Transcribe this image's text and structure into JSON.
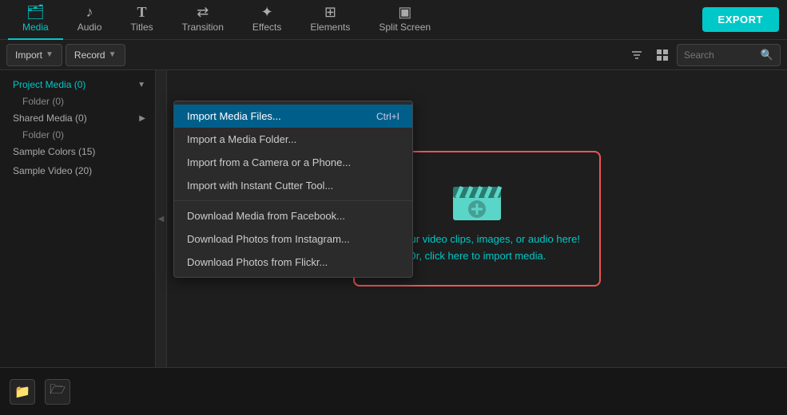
{
  "topNav": {
    "items": [
      {
        "id": "media",
        "label": "Media",
        "icon": "🗂",
        "active": true
      },
      {
        "id": "audio",
        "label": "Audio",
        "icon": "♪"
      },
      {
        "id": "titles",
        "label": "Titles",
        "icon": "T"
      },
      {
        "id": "transition",
        "label": "Transition",
        "icon": "⇄"
      },
      {
        "id": "effects",
        "label": "Effects",
        "icon": "✦"
      },
      {
        "id": "elements",
        "label": "Elements",
        "icon": "⊞"
      },
      {
        "id": "splitscreen",
        "label": "Split Screen",
        "icon": "▣"
      }
    ],
    "export_label": "EXPORT"
  },
  "toolbar": {
    "import_label": "Import",
    "record_label": "Record",
    "search_placeholder": "Search"
  },
  "sidebar": {
    "items": [
      {
        "id": "project-media",
        "label": "Project Media (0)",
        "has_chevron": true,
        "active": true
      },
      {
        "id": "folder",
        "label": "Folder (0)",
        "indent": true
      },
      {
        "id": "shared-media",
        "label": "Shared Media (0)",
        "has_chevron": true
      },
      {
        "id": "shared-folder",
        "label": "Folder (0)",
        "indent": true
      },
      {
        "id": "sample-colors",
        "label": "Sample Colors (15)"
      },
      {
        "id": "sample-video",
        "label": "Sample Video (20)"
      }
    ]
  },
  "dropdown": {
    "items": [
      {
        "id": "import-files",
        "label": "Import Media Files...",
        "shortcut": "Ctrl+I",
        "highlighted": true
      },
      {
        "id": "import-folder",
        "label": "Import a Media Folder..."
      },
      {
        "id": "import-camera",
        "label": "Import from a Camera or a Phone..."
      },
      {
        "id": "import-cutter",
        "label": "Import with Instant Cutter Tool..."
      },
      {
        "id": "divider1",
        "divider": true
      },
      {
        "id": "download-facebook",
        "label": "Download Media from Facebook..."
      },
      {
        "id": "download-instagram",
        "label": "Download Photos from Instagram..."
      },
      {
        "id": "download-flickr",
        "label": "Download Photos from Flickr..."
      }
    ]
  },
  "dropzone": {
    "line1": "Drop your video clips, images, or audio here!",
    "line2": "Or, click here to import media."
  },
  "bottomBar": {
    "add_folder_label": "Add Folder",
    "new_folder_label": "New Folder"
  }
}
